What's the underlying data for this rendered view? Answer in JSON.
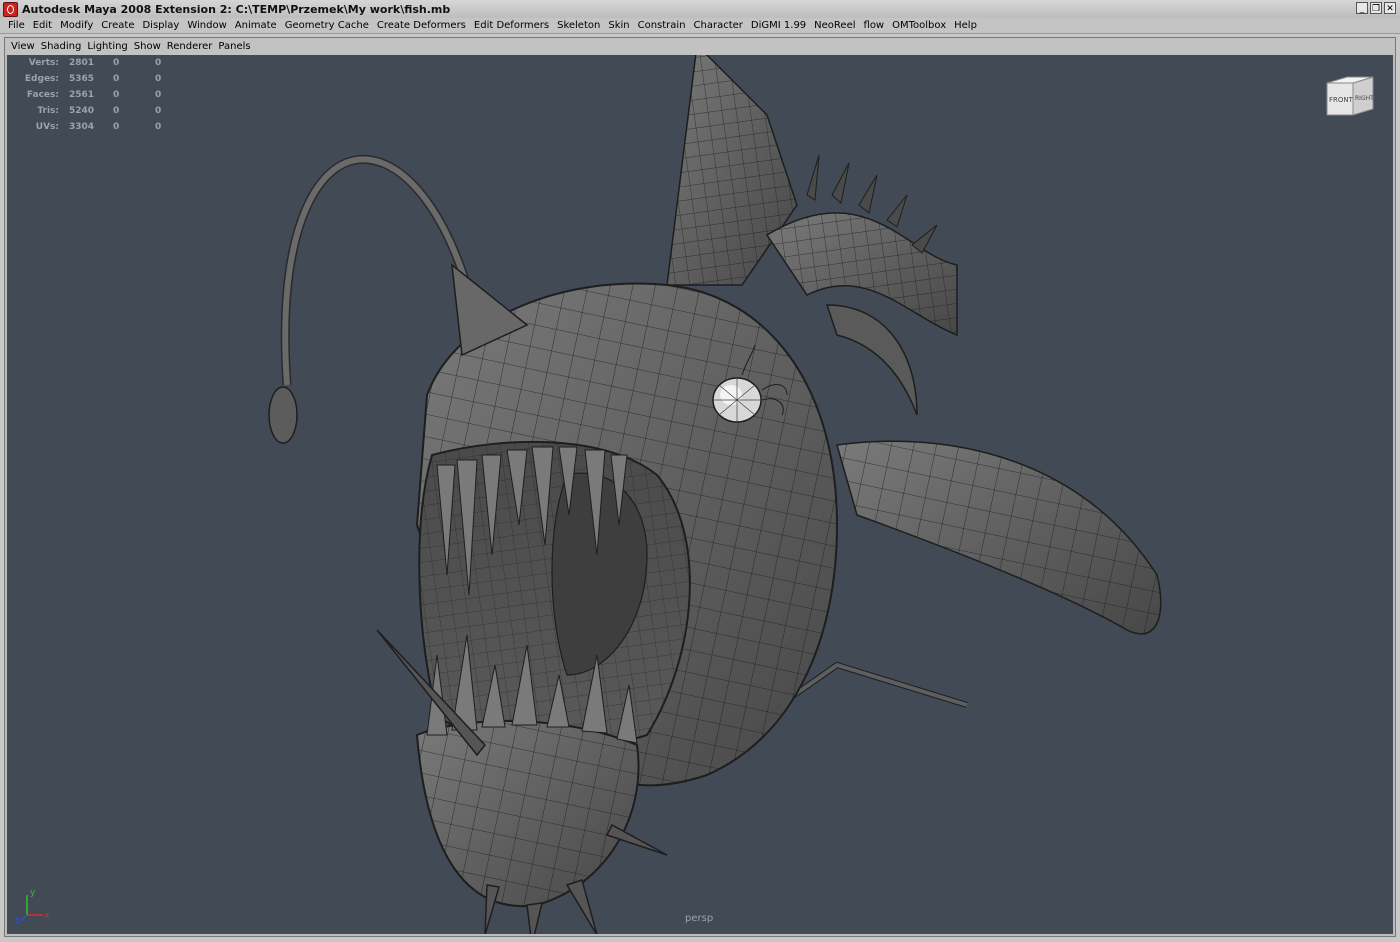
{
  "window": {
    "title": "Autodesk Maya 2008 Extension 2: C:\\TEMP\\Przemek\\My work\\fish.mb",
    "controls": [
      "minimize",
      "restore",
      "close"
    ]
  },
  "menubar": {
    "items": [
      "File",
      "Edit",
      "Modify",
      "Create",
      "Display",
      "Window",
      "Animate",
      "Geometry Cache",
      "Create Deformers",
      "Edit Deformers",
      "Skeleton",
      "Skin",
      "Constrain",
      "Character",
      "DiGMI 1.99",
      "NeoReel",
      "flow",
      "OMToolbox",
      "Help"
    ]
  },
  "panel_menu": {
    "items": [
      "View",
      "Shading",
      "Lighting",
      "Show",
      "Renderer",
      "Panels"
    ]
  },
  "hud": {
    "rows": [
      {
        "label": "Verts:",
        "total": "2801",
        "sel1": "0",
        "sel2": "0"
      },
      {
        "label": "Edges:",
        "total": "5365",
        "sel1": "0",
        "sel2": "0"
      },
      {
        "label": "Faces:",
        "total": "2561",
        "sel1": "0",
        "sel2": "0"
      },
      {
        "label": "Tris:",
        "total": "5240",
        "sel1": "0",
        "sel2": "0"
      },
      {
        "label": "UVs:",
        "total": "3304",
        "sel1": "0",
        "sel2": "0"
      }
    ]
  },
  "viewcube": {
    "front": "FRONT",
    "right": "RIGHT"
  },
  "viewport": {
    "camera": "persp"
  },
  "axes": {
    "x": "x",
    "y": "y",
    "z": "z",
    "x_color": "#d83030",
    "y_color": "#30c030",
    "z_color": "#3050e0"
  },
  "colors": {
    "viewport_bg": "#414a55",
    "model_fill": "#5e5e5e",
    "wire": "#1e1e1e"
  }
}
